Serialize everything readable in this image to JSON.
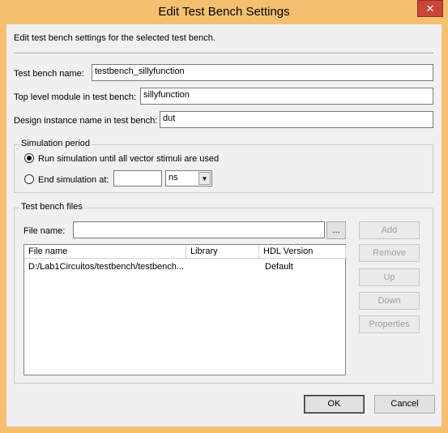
{
  "window": {
    "title": "Edit Test Bench Settings",
    "close_glyph": "✕"
  },
  "description": "Edit test bench settings for the selected test bench.",
  "fields": {
    "test_bench_name": {
      "label": "Test bench name:",
      "value": "testbench_sillyfunction"
    },
    "top_level_module": {
      "label": "Top level module in test bench:",
      "value": "sillyfunction"
    },
    "design_instance": {
      "label": "Design instance name in test bench:",
      "value": "dut"
    }
  },
  "simulation_period": {
    "title": "Simulation period",
    "option_run_all": "Run simulation until all vector stimuli are used",
    "option_end_at": "End simulation at:",
    "end_value": "",
    "unit": "ns",
    "selected": "run_all"
  },
  "test_bench_files": {
    "title": "Test bench files",
    "file_name_label": "File name:",
    "file_name_value": "",
    "browse_label": "...",
    "columns": [
      "File name",
      "Library",
      "HDL Version"
    ],
    "rows": [
      {
        "file_name": "D:/Lab1Circuitos/testbench/testbench...",
        "library": "",
        "hdl_version": "Default"
      }
    ],
    "buttons": {
      "add": "Add",
      "remove": "Remove",
      "up": "Up",
      "down": "Down",
      "properties": "Properties"
    }
  },
  "footer": {
    "ok": "OK",
    "cancel": "Cancel"
  }
}
